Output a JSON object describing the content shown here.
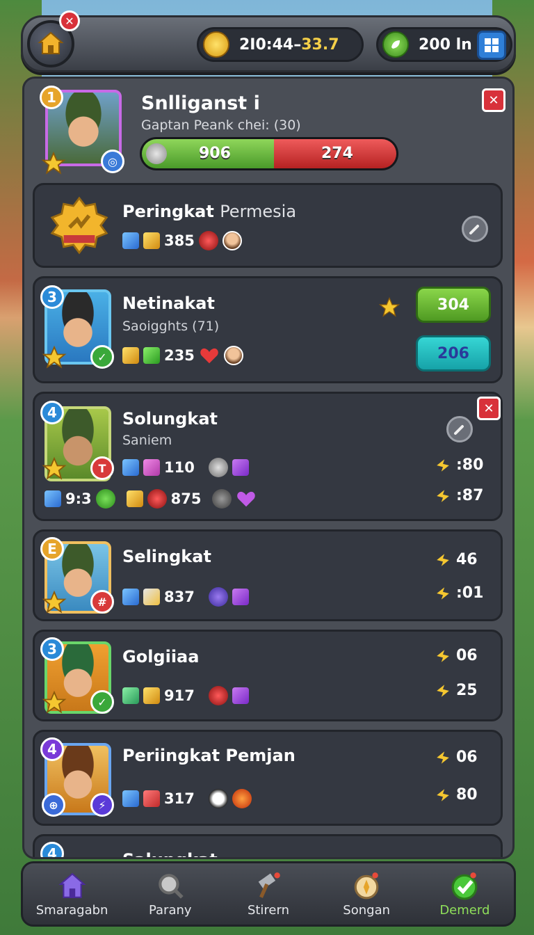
{
  "topbar": {
    "coins_label": "2I0:44–",
    "coins_highlight": "33.7",
    "energy_label": "200 ln"
  },
  "profile": {
    "name": "Snlliganst i",
    "subtitle": "Gaptan Peank chei: (30)",
    "rank": "1",
    "bar_left": "906",
    "bar_right": "274",
    "bar_left_fraction": 0.52
  },
  "cards": [
    {
      "title_bold": "Peringkat",
      "title_thin": "Permesia",
      "resource_value": "385"
    },
    {
      "rank": "3",
      "title": "Netinakat",
      "subtitle": "Saoigghts (71)",
      "resource_value": "235",
      "primary_button": "304",
      "secondary_button": "206"
    },
    {
      "rank": "4",
      "title": "Solungkat",
      "subtitle": "Saniem",
      "row1_value": "110",
      "row2_prefix": "9:3",
      "row2_value": "875",
      "score1": ":80",
      "score2": ":87"
    },
    {
      "rank": "E",
      "title": "Selingkat",
      "resource_value": "837",
      "score1": "46",
      "score2": ":01"
    },
    {
      "rank": "3",
      "title": "Golgiiaa",
      "resource_value": "917",
      "score1": "06",
      "score2": "25"
    },
    {
      "rank": "4",
      "title": "Periingkat Pemjan",
      "resource_value": "317",
      "score1": "06",
      "score2": "80"
    },
    {
      "rank": "4",
      "title": "Salungkat"
    }
  ],
  "nav": [
    {
      "label": "Smaragabn",
      "icon": "house-icon"
    },
    {
      "label": "Parany",
      "icon": "magnifier-icon"
    },
    {
      "label": "Stirern",
      "icon": "hammer-icon"
    },
    {
      "label": "Songan",
      "icon": "compass-icon"
    },
    {
      "label": "Demerd",
      "icon": "checkmark-icon",
      "active": true
    }
  ],
  "colors": {
    "accent_green": "#8fe05a",
    "close_red": "#d8313a",
    "coin_gold": "#f5d048"
  }
}
